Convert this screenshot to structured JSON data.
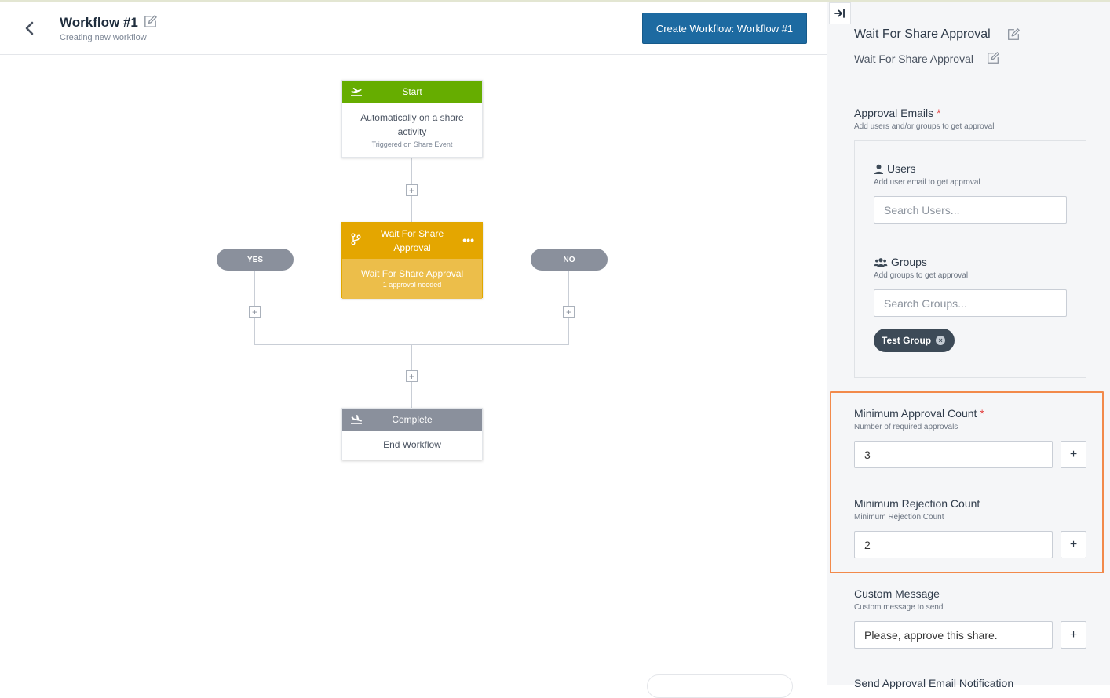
{
  "header": {
    "title": "Workflow #1",
    "subtitle": "Creating new workflow",
    "create_button": "Create Workflow: Workflow #1"
  },
  "canvas": {
    "start_node": {
      "title": "Start",
      "main": "Automatically on a share activity",
      "sub": "Triggered on Share Event"
    },
    "wait_node": {
      "title": "Wait For Share Approval",
      "main": "Wait For Share Approval",
      "sub": "1 approval needed",
      "menu": "•••"
    },
    "yes_label": "YES",
    "no_label": "NO",
    "complete_node": {
      "title": "Complete",
      "main": "End Workflow"
    },
    "plus_symbol": "+"
  },
  "sidebar": {
    "title": "Wait For Share Approval",
    "subtitle": "Wait For Share Approval",
    "approval_emails": {
      "label": "Approval Emails",
      "required": "*",
      "help": "Add users and/or groups to get approval",
      "users": {
        "label": "Users",
        "help": "Add user email to get approval",
        "placeholder": "Search Users..."
      },
      "groups": {
        "label": "Groups",
        "help": "Add groups to get approval",
        "placeholder": "Search Groups...",
        "chips": [
          "Test Group"
        ]
      }
    },
    "min_approval": {
      "label": "Minimum Approval Count",
      "required": "*",
      "help": "Number of required approvals",
      "value": "3"
    },
    "min_rejection": {
      "label": "Minimum Rejection Count",
      "help": "Minimum Rejection Count",
      "value": "2"
    },
    "custom_message": {
      "label": "Custom Message",
      "help": "Custom message to send",
      "value": "Please, approve this share."
    },
    "send_notification_label": "Send Approval Email Notification",
    "add_symbol": "+"
  },
  "colors": {
    "primary": "#1d6aa1",
    "start": "#66ad00",
    "wait": "#e4a600",
    "wait_body": "#ecbe4a",
    "complete": "#8a909c",
    "highlight": "#f28a4b",
    "required": "#e23c3c"
  }
}
